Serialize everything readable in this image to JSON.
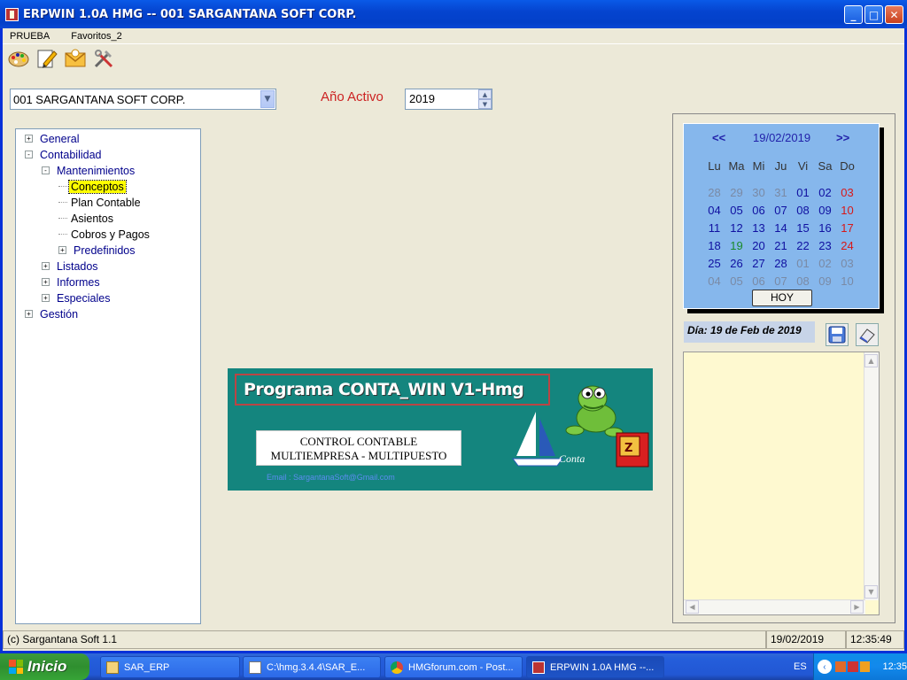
{
  "window": {
    "title": "ERPWIN 1.0A HMG -- 001 SARGANTANA SOFT CORP."
  },
  "menu": [
    "PRUEBA",
    "Favoritos_2"
  ],
  "toolbar": {
    "icons": [
      "palette-icon",
      "edit-icon",
      "mail-icon",
      "tools-icon"
    ]
  },
  "company": {
    "selected": "001 SARGANTANA SOFT CORP."
  },
  "year": {
    "label": "Año Activo",
    "value": "2019"
  },
  "tree": [
    {
      "label": "General",
      "level": 0,
      "expander": "+"
    },
    {
      "label": "Contabilidad",
      "level": 0,
      "expander": "-"
    },
    {
      "label": "Mantenimientos",
      "level": 1,
      "expander": "-"
    },
    {
      "label": "Conceptos",
      "level": 2,
      "selected": true
    },
    {
      "label": "Plan Contable",
      "level": 2
    },
    {
      "label": "Asientos",
      "level": 2
    },
    {
      "label": "Cobros y Pagos",
      "level": 2
    },
    {
      "label": "Predefinidos",
      "level": 2,
      "expander": "+"
    },
    {
      "label": "Listados",
      "level": 1,
      "expander": "+"
    },
    {
      "label": "Informes",
      "level": 1,
      "expander": "+"
    },
    {
      "label": "Especiales",
      "level": 1,
      "expander": "+"
    },
    {
      "label": "Gestión",
      "level": 0,
      "expander": "+"
    }
  ],
  "banner": {
    "title": "Programa CONTA_WIN V1-Hmg",
    "line1": "CONTROL CONTABLE",
    "line2": "MULTIEMPRESA - MULTIPUESTO",
    "email": "Email : SargantanaSoft@Gmail.com"
  },
  "calendar": {
    "prev": "<<",
    "next": ">>",
    "current": "19/02/2019",
    "day_names": [
      "Lu",
      "Ma",
      "Mi",
      "Ju",
      "Vi",
      "Sa",
      "Do"
    ],
    "weeks": [
      [
        "28",
        "29",
        "30",
        "31",
        "01",
        "02",
        "03"
      ],
      [
        "04",
        "05",
        "06",
        "07",
        "08",
        "09",
        "10"
      ],
      [
        "11",
        "12",
        "13",
        "14",
        "15",
        "16",
        "17"
      ],
      [
        "18",
        "19",
        "20",
        "21",
        "22",
        "23",
        "24"
      ],
      [
        "25",
        "26",
        "27",
        "28",
        "01",
        "02",
        "03"
      ],
      [
        "04",
        "05",
        "06",
        "07",
        "08",
        "09",
        "10"
      ]
    ],
    "today_button": "HOY",
    "colors": {
      "current_month": "#1010a0",
      "other_month": "#7a8aa5",
      "sunday": "#d81818",
      "today": "#1a8a2a"
    }
  },
  "day_label": "Día: 19 de Feb de 2019",
  "status": {
    "copyright": "(c) Sargantana Soft 1.1",
    "date": "19/02/2019",
    "time": "12:35:49"
  },
  "taskbar": {
    "start": "Inicio",
    "tasks": [
      "SAR_ERP",
      "C:\\hmg.3.4.4\\SAR_E...",
      "HMGforum.com - Post...",
      "ERPWIN 1.0A HMG --..."
    ],
    "lang": "ES",
    "clock": "12:35"
  }
}
